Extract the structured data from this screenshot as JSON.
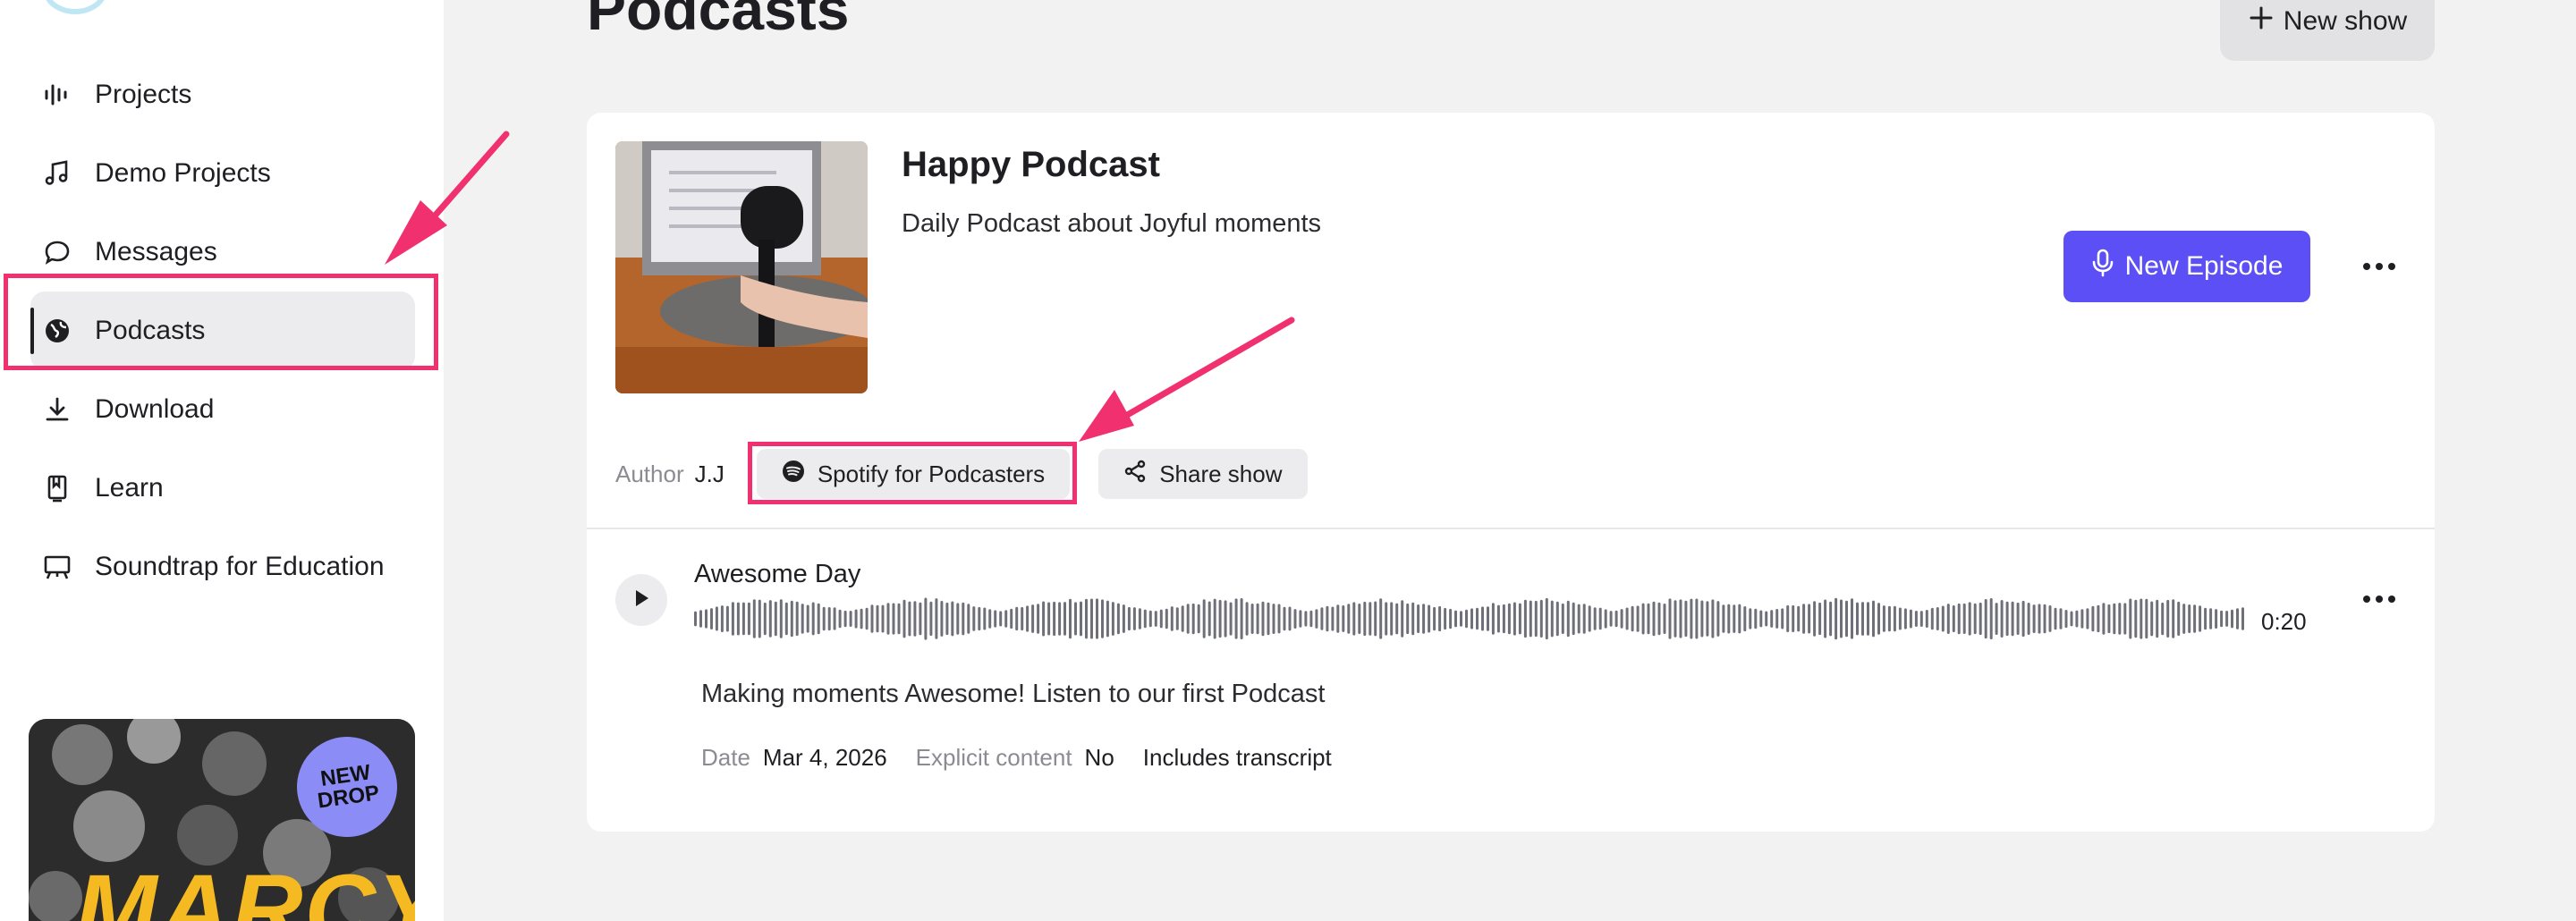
{
  "colors": {
    "accent": "#5b4ff5",
    "annotation": "#f1316f",
    "sidebar_bg": "#ffffff",
    "main_bg": "#f2f2f3"
  },
  "sidebar": {
    "items": [
      {
        "label": "Projects",
        "icon": "waveform-icon"
      },
      {
        "label": "Demo Projects",
        "icon": "music-note-icon"
      },
      {
        "label": "Messages",
        "icon": "chat-bubble-icon"
      },
      {
        "label": "Podcasts",
        "icon": "globe-icon",
        "active": true
      },
      {
        "label": "Download",
        "icon": "download-icon"
      },
      {
        "label": "Learn",
        "icon": "bookmark-icon"
      },
      {
        "label": "Soundtrap for Education",
        "icon": "presentation-board-icon"
      }
    ],
    "promo": {
      "badge_line1": "NEW",
      "badge_line2": "DROP",
      "word": "MARCY"
    }
  },
  "header": {
    "title": "Podcasts",
    "new_show_label": "New show"
  },
  "show": {
    "title": "Happy Podcast",
    "description": "Daily Podcast about Joyful moments",
    "new_episode_label": "New Episode",
    "author_label": "Author",
    "author": "J.J",
    "spotify_label": "Spotify for Podcasters",
    "share_label": "Share show"
  },
  "episode": {
    "title": "Awesome Day",
    "duration": "0:20",
    "description": "Making moments Awesome! Listen to our first Podcast",
    "date_label": "Date",
    "date": "Mar 4, 2026",
    "explicit_label": "Explicit content",
    "explicit": "No",
    "transcript": "Includes transcript"
  }
}
